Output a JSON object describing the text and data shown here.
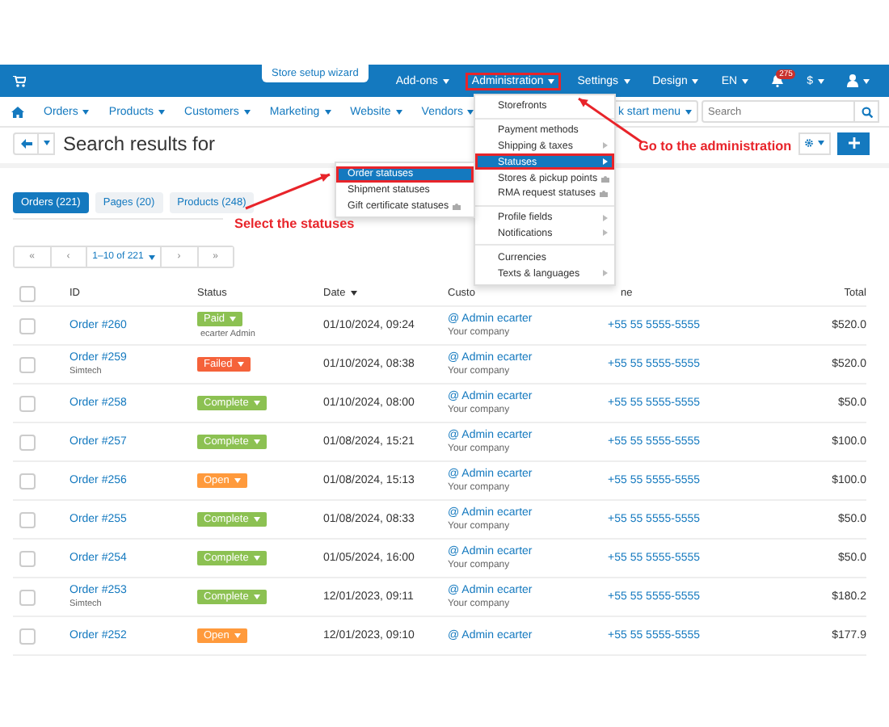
{
  "top_bar": {
    "wizard": "Store setup wizard",
    "menus": [
      {
        "kind": "menu",
        "label": "Add-ons",
        "highlighted": false
      },
      {
        "kind": "menu",
        "label": "Administration",
        "highlighted": true
      },
      {
        "kind": "menu",
        "label": "Settings",
        "highlighted": false
      },
      {
        "kind": "menu",
        "label": "Design",
        "highlighted": false
      },
      {
        "kind": "menu",
        "label": "EN",
        "highlighted": false
      },
      {
        "kind": "bell",
        "label": "275",
        "highlighted": false
      },
      {
        "kind": "menu",
        "label": "$",
        "highlighted": false
      },
      {
        "kind": "user",
        "highlighted": false
      }
    ]
  },
  "nav": {
    "items": [
      "Orders",
      "Products",
      "Customers",
      "Marketing",
      "Website",
      "Vendors"
    ],
    "quick_start": "k start menu",
    "search": {
      "placeholder": "Search"
    }
  },
  "page_title": "Search results for",
  "result_tabs": [
    {
      "label": "Orders (221)",
      "selected": true
    },
    {
      "label": "Pages (20)",
      "selected": false
    },
    {
      "label": "Products (248)",
      "selected": false
    }
  ],
  "pagination": {
    "first": "«",
    "prev": "‹",
    "range": "1–10 of 221",
    "next": "›",
    "last": "»"
  },
  "table": {
    "columns": [
      "ID",
      "Status",
      "Date",
      "Custo",
      "ne",
      "Total"
    ],
    "all_checked": false,
    "rows": [
      {
        "checked": false,
        "id": "Order #260",
        "vendor": "",
        "status": "Paid",
        "color": "#8cc152",
        "status_note": "ecarter Admin",
        "date": "01/10/2024, 09:24",
        "customer": "@ Admin ecarter",
        "company": "Your company",
        "phone": "+55 55 5555-5555",
        "total": "$520.0"
      },
      {
        "checked": false,
        "id": "Order #259",
        "vendor": "Simtech",
        "status": "Failed",
        "color": "#f5623a",
        "status_note": "",
        "date": "01/10/2024, 08:38",
        "customer": "@ Admin ecarter",
        "company": "Your company",
        "phone": "+55 55 5555-5555",
        "total": "$520.0"
      },
      {
        "checked": false,
        "id": "Order #258",
        "vendor": "",
        "status": "Complete",
        "color": "#8cc152",
        "status_note": "",
        "date": "01/10/2024, 08:00",
        "customer": "@ Admin ecarter",
        "company": "Your company",
        "phone": "+55 55 5555-5555",
        "total": "$50.0"
      },
      {
        "checked": false,
        "id": "Order #257",
        "vendor": "",
        "status": "Complete",
        "color": "#8cc152",
        "status_note": "",
        "date": "01/08/2024, 15:21",
        "customer": "@ Admin ecarter",
        "company": "Your company",
        "phone": "+55 55 5555-5555",
        "total": "$100.0"
      },
      {
        "checked": false,
        "id": "Order #256",
        "vendor": "",
        "status": "Open",
        "color": "#ff9a3c",
        "status_note": "",
        "date": "01/08/2024, 15:13",
        "customer": "@ Admin ecarter",
        "company": "Your company",
        "phone": "+55 55 5555-5555",
        "total": "$100.0"
      },
      {
        "checked": false,
        "id": "Order #255",
        "vendor": "",
        "status": "Complete",
        "color": "#8cc152",
        "status_note": "",
        "date": "01/08/2024, 08:33",
        "customer": "@ Admin ecarter",
        "company": "Your company",
        "phone": "+55 55 5555-5555",
        "total": "$50.0"
      },
      {
        "checked": false,
        "id": "Order #254",
        "vendor": "",
        "status": "Complete",
        "color": "#8cc152",
        "status_note": "",
        "date": "01/05/2024, 16:00",
        "customer": "@ Admin ecarter",
        "company": "Your company",
        "phone": "+55 55 5555-5555",
        "total": "$50.0"
      },
      {
        "checked": false,
        "id": "Order #253",
        "vendor": "Simtech",
        "status": "Complete",
        "color": "#8cc152",
        "status_note": "",
        "date": "12/01/2023, 09:11",
        "customer": "@ Admin ecarter",
        "company": "Your company",
        "phone": "+55 55 5555-5555",
        "total": "$180.2"
      },
      {
        "checked": false,
        "id": "Order #252",
        "vendor": "",
        "status": "Open",
        "color": "#ff9a3c",
        "status_note": "",
        "date": "12/01/2023, 09:10",
        "customer": "@ Admin ecarter",
        "company": "",
        "phone": "+55 55 5555-5555",
        "total": "$177.9"
      }
    ]
  },
  "admin_menu": {
    "groups": [
      [
        {
          "label": "Storefronts",
          "submenu": false,
          "addon": false,
          "selected": false,
          "highlighted": false
        }
      ],
      [
        {
          "label": "Payment methods",
          "submenu": false,
          "addon": false,
          "selected": false,
          "highlighted": false
        },
        {
          "label": "Shipping & taxes",
          "submenu": true,
          "addon": false,
          "selected": false,
          "highlighted": false
        },
        {
          "label": "Statuses",
          "submenu": true,
          "addon": false,
          "selected": true,
          "highlighted": true
        },
        {
          "label": "Stores & pickup points",
          "submenu": false,
          "addon": true,
          "selected": false,
          "highlighted": false
        },
        {
          "label": "RMA request statuses",
          "submenu": false,
          "addon": true,
          "selected": false,
          "highlighted": false
        }
      ],
      [
        {
          "label": "Profile fields",
          "submenu": true,
          "addon": false,
          "selected": false,
          "highlighted": false
        },
        {
          "label": "Notifications",
          "submenu": true,
          "addon": false,
          "selected": false,
          "highlighted": false
        }
      ],
      [
        {
          "label": "Currencies",
          "submenu": false,
          "addon": false,
          "selected": false,
          "highlighted": false
        },
        {
          "label": "Texts & languages",
          "submenu": true,
          "addon": false,
          "selected": false,
          "highlighted": false
        }
      ]
    ]
  },
  "statuses_submenu": [
    {
      "label": "Order statuses",
      "addon": false,
      "selected": true,
      "highlighted": true
    },
    {
      "label": "Shipment statuses",
      "addon": false,
      "selected": false,
      "highlighted": false
    },
    {
      "label": "Gift certificate statuses",
      "addon": true,
      "selected": false,
      "highlighted": false
    }
  ],
  "callouts": [
    {
      "text": "Go to the administration"
    },
    {
      "text": "Select the statuses"
    }
  ]
}
